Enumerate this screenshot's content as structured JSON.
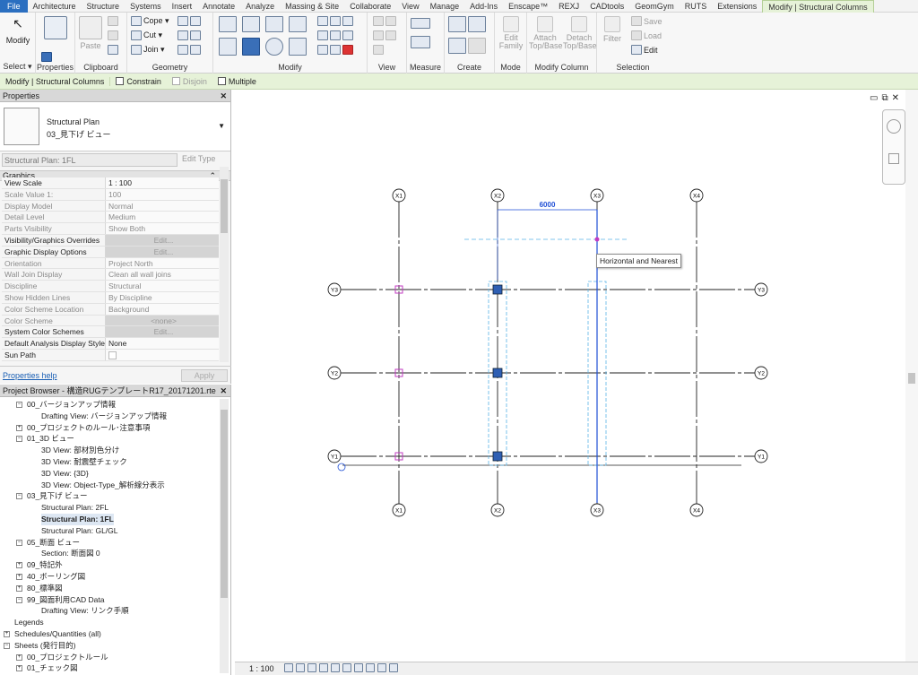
{
  "ribbon_tabs": [
    "File",
    "Architecture",
    "Structure",
    "Systems",
    "Insert",
    "Annotate",
    "Analyze",
    "Massing & Site",
    "Collaborate",
    "View",
    "Manage",
    "Add-Ins",
    "Enscape™",
    "REXJ",
    "CADtools",
    "GeomGym",
    "RUTS",
    "Extensions",
    "Modify | Structural Columns"
  ],
  "ribbon": {
    "select": {
      "modify_label": "Modify",
      "panel": "Select ▾"
    },
    "properties": {
      "panel": "Properties"
    },
    "clipboard": {
      "paste_label": "Paste",
      "panel": "Clipboard"
    },
    "geometry": {
      "cope": "Cope ▾",
      "cut": "Cut ▾",
      "join": "Join ▾",
      "panel": "Geometry"
    },
    "modify": {
      "panel": "Modify"
    },
    "view": {
      "panel": "View"
    },
    "measure": {
      "panel": "Measure"
    },
    "create": {
      "panel": "Create"
    },
    "mode": {
      "edit_family": "Edit Family",
      "panel": "Mode"
    },
    "modify_column": {
      "attach": "Attach Top/Base",
      "detach": "Detach Top/Base",
      "panel": "Modify Column"
    },
    "selection": {
      "filter": "Filter",
      "save": "Save",
      "load": "Load",
      "edit": "Edit",
      "panel": "Selection"
    }
  },
  "options_bar": {
    "context": "Modify | Structural Columns",
    "constrain": "Constrain",
    "disjoin": "Disjoin",
    "multiple": "Multiple"
  },
  "properties": {
    "title": "Properties",
    "type_name_1": "Structural Plan",
    "type_name_2": "03_見下げ ビュー",
    "instance_selector": "Structural Plan: 1FL",
    "edit_type": "Edit Type",
    "group": "Graphics",
    "rows": [
      {
        "key": "View Scale",
        "value": "1 : 100",
        "dark": true
      },
      {
        "key": "Scale Value    1:",
        "value": "100",
        "dark": false
      },
      {
        "key": "Display Model",
        "value": "Normal",
        "dark": false
      },
      {
        "key": "Detail Level",
        "value": "Medium",
        "dark": false
      },
      {
        "key": "Parts Visibility",
        "value": "Show Both",
        "dark": false
      },
      {
        "key": "Visibility/Graphics Overrides",
        "value": "Edit...",
        "dark": true,
        "btn": true
      },
      {
        "key": "Graphic Display Options",
        "value": "Edit...",
        "dark": true,
        "btn": true
      },
      {
        "key": "Orientation",
        "value": "Project North",
        "dark": false
      },
      {
        "key": "Wall Join Display",
        "value": "Clean all wall joins",
        "dark": false
      },
      {
        "key": "Discipline",
        "value": "Structural",
        "dark": false
      },
      {
        "key": "Show Hidden Lines",
        "value": "By Discipline",
        "dark": false
      },
      {
        "key": "Color Scheme Location",
        "value": "Background",
        "dark": false
      },
      {
        "key": "Color Scheme",
        "value": "<none>",
        "dark": false,
        "btn": true
      },
      {
        "key": "System Color Schemes",
        "value": "Edit...",
        "dark": true,
        "btn": true
      },
      {
        "key": "Default Analysis Display Style",
        "value": "None",
        "dark": true
      },
      {
        "key": "Sun Path",
        "value": "",
        "dark": true
      }
    ],
    "help_link": "Properties help",
    "apply": "Apply"
  },
  "browser": {
    "title": "Project Browser - 構造RUGテンプレートR17_20171201.rte",
    "nodes": [
      {
        "label": "00_バージョンアップ情報",
        "level": 1,
        "pm": "−"
      },
      {
        "label": "Drafting View: バージョンアップ情報",
        "level": 2,
        "pm": ""
      },
      {
        "label": "00_プロジェクトのルール･注意事項",
        "level": 1,
        "pm": "+"
      },
      {
        "label": "01_3D ビュー",
        "level": 1,
        "pm": "−"
      },
      {
        "label": "3D View: 部材別色分け",
        "level": 2,
        "pm": ""
      },
      {
        "label": "3D View: 耐震壁チェック",
        "level": 2,
        "pm": ""
      },
      {
        "label": "3D View: {3D}",
        "level": 2,
        "pm": ""
      },
      {
        "label": "3D View: Object-Type_解析線分表示",
        "level": 2,
        "pm": ""
      },
      {
        "label": "03_見下げ ビュー",
        "level": 1,
        "pm": "−"
      },
      {
        "label": "Structural Plan: 2FL",
        "level": 2,
        "pm": ""
      },
      {
        "label": "Structural Plan: 1FL",
        "level": 2,
        "pm": "",
        "selected": true
      },
      {
        "label": "Structural Plan: GL/GL",
        "level": 2,
        "pm": ""
      },
      {
        "label": "05_断面 ビュー",
        "level": 1,
        "pm": "−"
      },
      {
        "label": "Section: 断面図 0",
        "level": 2,
        "pm": ""
      },
      {
        "label": "09_特記外",
        "level": 1,
        "pm": "+"
      },
      {
        "label": "40_ボーリング図",
        "level": 1,
        "pm": "+"
      },
      {
        "label": "80_標準図",
        "level": 1,
        "pm": "+"
      },
      {
        "label": "99_図面利用CAD Data",
        "level": 1,
        "pm": "−"
      },
      {
        "label": "Drafting View: リンク手順",
        "level": 2,
        "pm": ""
      },
      {
        "label": "Legends",
        "level": 0,
        "pm": ""
      },
      {
        "label": "Schedules/Quantities (all)",
        "level": 0,
        "pm": "+"
      },
      {
        "label": "Sheets (発行目的)",
        "level": 0,
        "pm": "−"
      },
      {
        "label": "00_プロジェクトルール",
        "level": 1,
        "pm": "+"
      },
      {
        "label": "01_チェック図",
        "level": 1,
        "pm": "+"
      }
    ]
  },
  "drawing": {
    "grid_x": [
      "X1",
      "X2",
      "X3",
      "X4"
    ],
    "grid_y": [
      "Y3",
      "Y2",
      "Y1"
    ],
    "dimension": "6000",
    "tooltip": "Horizontal and Nearest"
  },
  "status": {
    "scale": "1 : 100"
  },
  "colors": {
    "accent": "#2b6fc0",
    "context_tab": "#e6f2d8",
    "dimension": "#1f4fd6",
    "column_fill": "#2f5fb3",
    "column_pink": "#c23bc2",
    "cyan_dash": "#5ab4e6"
  }
}
